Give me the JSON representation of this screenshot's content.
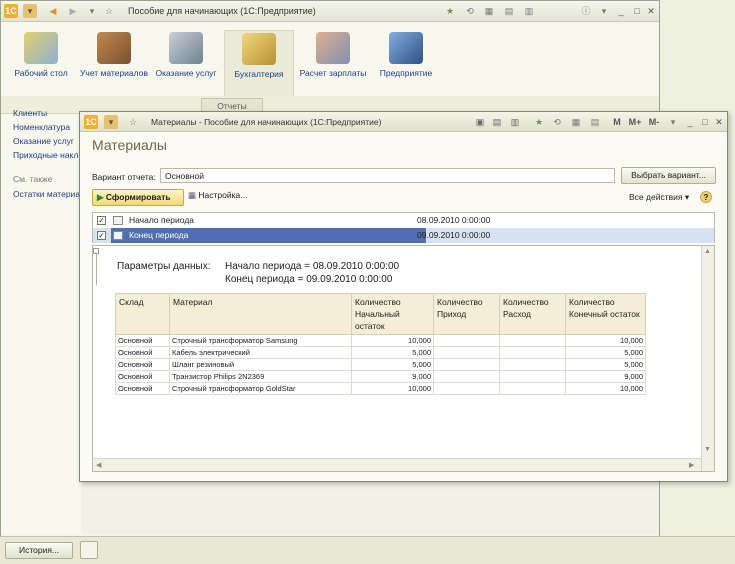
{
  "main_window": {
    "title": "Пособие для начинающих  (1С:Предприятие)",
    "sections": [
      {
        "label": "Рабочий стол"
      },
      {
        "label": "Учет материалов"
      },
      {
        "label": "Оказание услуг"
      },
      {
        "label": "Бухгалтерия"
      },
      {
        "label": "Расчет зарплаты"
      },
      {
        "label": "Предприятие"
      }
    ],
    "tab": "Отчеты",
    "left_links": [
      "Клиенты",
      "Номенклатура",
      "Оказание услуг",
      "Приходные накл"
    ],
    "see_also_label": "См. также",
    "see_also_links": [
      "Остатки материал"
    ],
    "history_button": "История..."
  },
  "report_window": {
    "title": "Материалы - Пособие для начинающих  (1С:Предприятие)",
    "toolbar_right": [
      "M",
      "M+",
      "M-"
    ],
    "heading": "Материалы",
    "variant_label": "Вариант отчета:",
    "variant_value": "Основной",
    "choose_variant_button": "Выбрать вариант...",
    "form_button": "Сформировать",
    "settings_button": "Настройка...",
    "all_actions": "Все действия ▾",
    "params": [
      {
        "name": "Начало периода",
        "value": "08.09.2010 0:00:00",
        "checked": true
      },
      {
        "name": "Конец периода",
        "value": "09.09.2010 0:00:00",
        "checked": true
      }
    ],
    "report": {
      "params_caption": "Параметры данных:",
      "param_lines": [
        "Начало периода = 08.09.2010 0:00:00",
        "Конец периода = 09.09.2010 0:00:00"
      ],
      "columns": [
        "Склад",
        "Материал",
        "Количество Начальный остаток",
        "Количество Приход",
        "Количество Расход",
        "Количество Конечный остаток"
      ],
      "rows": [
        [
          "Основной",
          "Строчный трансформатор Samsung",
          "10,000",
          "",
          "",
          "10,000"
        ],
        [
          "Основной",
          "Кабель электрический",
          "5,000",
          "",
          "",
          "5,000"
        ],
        [
          "Основной",
          "Шланг резиновый",
          "5,000",
          "",
          "",
          "5,000"
        ],
        [
          "Основной",
          "Транзистор Philips 2N2369",
          "9,000",
          "",
          "",
          "9,000"
        ],
        [
          "Основной",
          "Строчный трансформатор GoldStar",
          "10,000",
          "",
          "",
          "10,000"
        ]
      ]
    }
  },
  "colors": {
    "accent_link": "#1f3f7f",
    "heading": "#6a6a3e",
    "selected_row": "#4f6fb0",
    "header_bg": "#f4eed6"
  }
}
